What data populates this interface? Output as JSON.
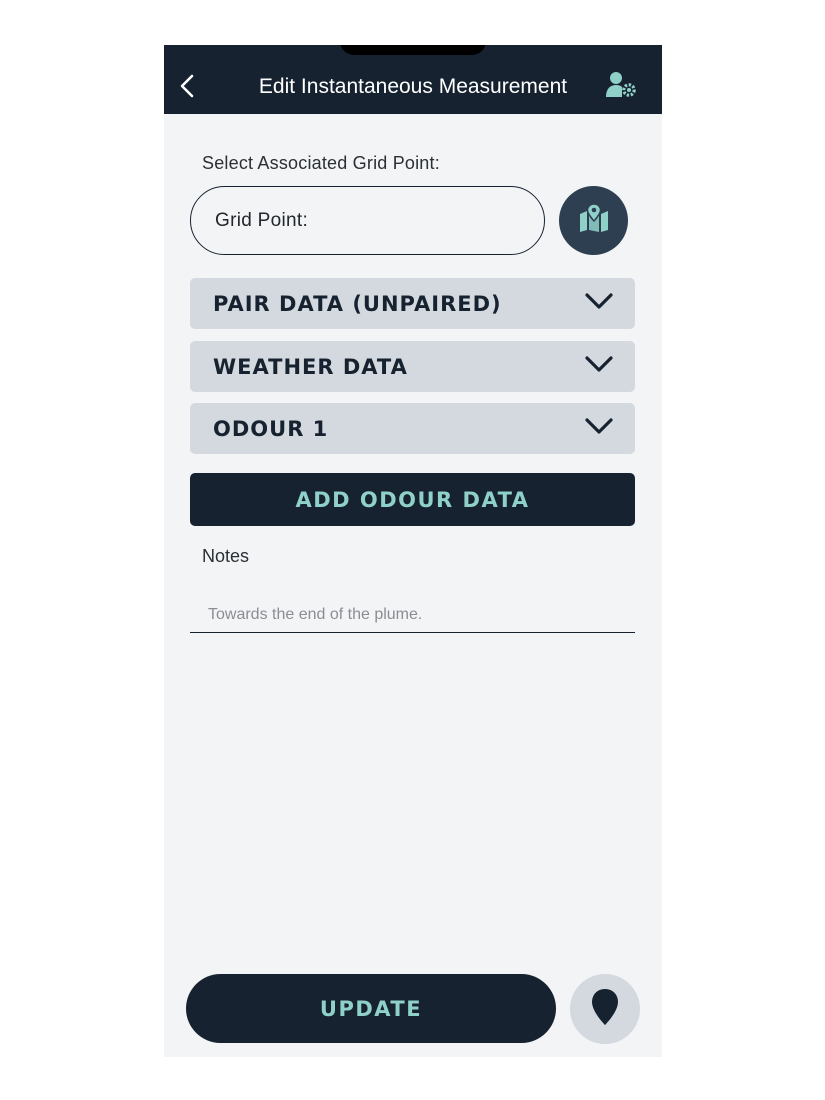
{
  "header": {
    "title": "Edit Instantaneous Measurement",
    "back_icon": "chevron-left-icon",
    "settings_icon": "user-settings-icon"
  },
  "grid_point": {
    "label": "Select Associated Grid Point:",
    "field_value": "Grid Point:",
    "map_icon": "map-location-icon"
  },
  "sections": [
    {
      "label": "PAIR DATA (UNPAIRED)"
    },
    {
      "label": "WEATHER DATA"
    },
    {
      "label": "ODOUR 1"
    }
  ],
  "add_odour": {
    "label": "ADD ODOUR DATA"
  },
  "notes": {
    "label": "Notes",
    "value": "Towards the end of the plume."
  },
  "footer": {
    "update_label": "UPDATE",
    "location_icon": "map-pin-icon"
  },
  "colors": {
    "header_bg": "#16222f",
    "accent_teal": "#8fd1c9",
    "accordion_bg": "#d4d8df",
    "page_bg": "#f3f4f6"
  }
}
